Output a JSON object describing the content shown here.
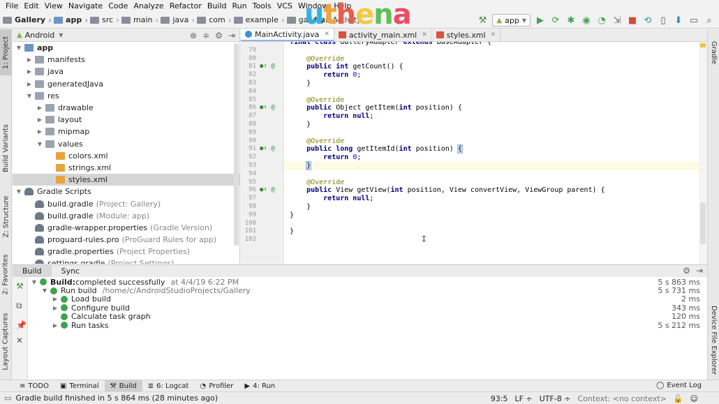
{
  "menu": [
    "File",
    "Edit",
    "View",
    "Navigate",
    "Code",
    "Analyze",
    "Refactor",
    "Build",
    "Run",
    "Tools",
    "VCS",
    "Window",
    "Help"
  ],
  "window_title_fragment": "MainActivity",
  "logo": {
    "u": "u",
    "t": "t",
    "h": "h",
    "e": "e",
    "n": "n",
    "a": "a"
  },
  "breadcrumb": [
    "Gallery",
    "app",
    "src",
    "main",
    "java",
    "com",
    "example",
    "gallery"
  ],
  "run_config": "app",
  "project_panel": {
    "view_selector": "Android",
    "tree": [
      {
        "label": "app",
        "hint": "",
        "indent": 0,
        "arrow": "▼",
        "icon": "folder-b",
        "bold": true
      },
      {
        "label": "manifests",
        "hint": "",
        "indent": 1,
        "arrow": "▶",
        "icon": "folder"
      },
      {
        "label": "java",
        "hint": "",
        "indent": 1,
        "arrow": "▶",
        "icon": "folder"
      },
      {
        "label": "generatedJava",
        "hint": "",
        "indent": 1,
        "arrow": "▶",
        "icon": "folder"
      },
      {
        "label": "res",
        "hint": "",
        "indent": 1,
        "arrow": "▼",
        "icon": "folder"
      },
      {
        "label": "drawable",
        "hint": "",
        "indent": 2,
        "arrow": "▶",
        "icon": "folder"
      },
      {
        "label": "layout",
        "hint": "",
        "indent": 2,
        "arrow": "▶",
        "icon": "folder"
      },
      {
        "label": "mipmap",
        "hint": "",
        "indent": 2,
        "arrow": "▶",
        "icon": "folder"
      },
      {
        "label": "values",
        "hint": "",
        "indent": 2,
        "arrow": "▼",
        "icon": "folder"
      },
      {
        "label": "colors.xml",
        "hint": "",
        "indent": 3,
        "arrow": "",
        "icon": "xml"
      },
      {
        "label": "strings.xml",
        "hint": "",
        "indent": 3,
        "arrow": "",
        "icon": "xml"
      },
      {
        "label": "styles.xml",
        "hint": "",
        "indent": 3,
        "arrow": "",
        "icon": "xml",
        "selected": true
      },
      {
        "label": "Gradle Scripts",
        "hint": "",
        "indent": 0,
        "arrow": "▼",
        "icon": "gradle"
      },
      {
        "label": "build.gradle",
        "hint": "(Project: Gallery)",
        "indent": 1,
        "arrow": "",
        "icon": "gradle"
      },
      {
        "label": "build.gradle",
        "hint": "(Module: app)",
        "indent": 1,
        "arrow": "",
        "icon": "gradle"
      },
      {
        "label": "gradle-wrapper.properties",
        "hint": "(Gradle Version)",
        "indent": 1,
        "arrow": "",
        "icon": "gradle"
      },
      {
        "label": "proguard-rules.pro",
        "hint": "(ProGuard Rules for app)",
        "indent": 1,
        "arrow": "",
        "icon": "gradle"
      },
      {
        "label": "gradle.properties",
        "hint": "(Project Properties)",
        "indent": 1,
        "arrow": "",
        "icon": "gradle"
      },
      {
        "label": "settings.gradle",
        "hint": "(Project Settings)",
        "indent": 1,
        "arrow": "",
        "icon": "gradle"
      }
    ]
  },
  "left_tabs": [
    "1: Project",
    "Build Variants",
    "Z: Structure",
    "2: Favorites",
    "Layout Captures"
  ],
  "right_tabs": [
    "Gradle",
    "Device File Explorer"
  ],
  "editor_tabs": [
    {
      "label": "MainActivity.java",
      "icon": "class",
      "active": true
    },
    {
      "label": "activity_main.xml",
      "icon": "xml",
      "active": false
    },
    {
      "label": "styles.xml",
      "icon": "xml",
      "active": false
    }
  ],
  "code_lines": [
    {
      "n": "",
      "parts": [
        [
          "kw",
          "final class "
        ],
        [
          "",
          "GalleryAdapter "
        ],
        [
          "kw",
          "extends "
        ],
        [
          "",
          "BaseAdapter {"
        ]
      ],
      "mark": ""
    },
    {
      "n": "79",
      "parts": [],
      "mark": ""
    },
    {
      "n": "80",
      "parts": [
        [
          "an",
          "    @Override"
        ]
      ],
      "mark": ""
    },
    {
      "n": "81",
      "parts": [
        [
          "kw",
          "    public int "
        ],
        [
          "",
          "getCount() {"
        ]
      ],
      "mark": "●↑ @"
    },
    {
      "n": "82",
      "parts": [
        [
          "kw",
          "        return "
        ],
        [
          "num",
          "0"
        ],
        [
          "",
          ";"
        ]
      ],
      "mark": ""
    },
    {
      "n": "83",
      "parts": [
        [
          "",
          "    }"
        ]
      ],
      "mark": ""
    },
    {
      "n": "84",
      "parts": [],
      "mark": ""
    },
    {
      "n": "85",
      "parts": [
        [
          "an",
          "    @Override"
        ]
      ],
      "mark": ""
    },
    {
      "n": "86",
      "parts": [
        [
          "kw",
          "    public "
        ],
        [
          "",
          "Object getItem("
        ],
        [
          "kw",
          "int "
        ],
        [
          "",
          "position) {"
        ]
      ],
      "mark": "●↑ @"
    },
    {
      "n": "87",
      "parts": [
        [
          "kw",
          "        return null"
        ],
        [
          "",
          ";"
        ]
      ],
      "mark": ""
    },
    {
      "n": "88",
      "parts": [
        [
          "",
          "    }"
        ]
      ],
      "mark": ""
    },
    {
      "n": "89",
      "parts": [],
      "mark": ""
    },
    {
      "n": "90",
      "parts": [
        [
          "an",
          "    @Override"
        ]
      ],
      "mark": ""
    },
    {
      "n": "91",
      "parts": [
        [
          "kw",
          "    public long "
        ],
        [
          "",
          "getItemId("
        ],
        [
          "kw",
          "int "
        ],
        [
          "",
          "position) "
        ],
        [
          "brk",
          "{"
        ]
      ],
      "mark": "●↑ @"
    },
    {
      "n": "92",
      "parts": [
        [
          "kw",
          "        return "
        ],
        [
          "num",
          "0"
        ],
        [
          "",
          ";"
        ]
      ],
      "mark": ""
    },
    {
      "n": "93",
      "parts": [
        [
          "",
          "    "
        ],
        [
          "brk",
          "}"
        ]
      ],
      "mark": "",
      "current": true
    },
    {
      "n": "94",
      "parts": [],
      "mark": ""
    },
    {
      "n": "95",
      "parts": [
        [
          "an",
          "    @Override"
        ]
      ],
      "mark": ""
    },
    {
      "n": "96",
      "parts": [
        [
          "kw",
          "    public "
        ],
        [
          "",
          "View getView("
        ],
        [
          "kw",
          "int "
        ],
        [
          "",
          "position, View convertView, ViewGroup parent) {"
        ]
      ],
      "mark": "●↑ @"
    },
    {
      "n": "97",
      "parts": [
        [
          "kw",
          "        return null"
        ],
        [
          "",
          ";"
        ]
      ],
      "mark": ""
    },
    {
      "n": "98",
      "parts": [
        [
          "",
          "    }"
        ]
      ],
      "mark": ""
    },
    {
      "n": "99",
      "parts": [
        [
          "",
          "}"
        ]
      ],
      "mark": ""
    },
    {
      "n": "100",
      "parts": [],
      "mark": ""
    },
    {
      "n": "101",
      "parts": [
        [
          "",
          "}"
        ]
      ],
      "mark": ""
    },
    {
      "n": "102",
      "parts": [],
      "mark": ""
    }
  ],
  "build_panel": {
    "tabs": [
      "Build",
      "Sync"
    ],
    "rows": [
      {
        "indent": 0,
        "arrow": "▼",
        "label_bold": "Build:",
        "label": "completed successfully",
        "detail": "at 4/4/19 6:22 PM",
        "duration": "5 s 863 ms"
      },
      {
        "indent": 1,
        "arrow": "▼",
        "label_bold": "",
        "label": "Run build",
        "detail": "/home/c/AndroidStudioProjects/Gallery",
        "duration": "5 s 731 ms"
      },
      {
        "indent": 2,
        "arrow": "▶",
        "label_bold": "",
        "label": "Load build",
        "detail": "",
        "duration": "2 ms"
      },
      {
        "indent": 2,
        "arrow": "▶",
        "label_bold": "",
        "label": "Configure build",
        "detail": "",
        "duration": "343 ms"
      },
      {
        "indent": 2,
        "arrow": "",
        "label_bold": "",
        "label": "Calculate task graph",
        "detail": "",
        "duration": "120 ms"
      },
      {
        "indent": 2,
        "arrow": "▶",
        "label_bold": "",
        "label": "Run tasks",
        "detail": "",
        "duration": "5 s 212 ms"
      }
    ]
  },
  "bottom_tools": [
    {
      "icon": "≡",
      "label": "TODO",
      "active": false
    },
    {
      "icon": "▣",
      "label": "Terminal",
      "active": false
    },
    {
      "icon": "⚒",
      "label": "Build",
      "active": true
    },
    {
      "icon": "≣",
      "label": "6: Logcat",
      "active": false
    },
    {
      "icon": "◔",
      "label": "Profiler",
      "active": false
    },
    {
      "icon": "▶",
      "label": "4: Run",
      "active": false
    }
  ],
  "event_log": "Event Log",
  "status": {
    "message": "Gradle build finished in 5 s 864 ms (28 minutes ago)",
    "position": "93:5",
    "line_sep": "LF ÷",
    "encoding": "UTF-8 ÷",
    "context": "Context: <no context>"
  },
  "colors": {
    "accent": "#3d8fd6",
    "success": "#3fa34d",
    "current_line": "#fdfce3"
  }
}
